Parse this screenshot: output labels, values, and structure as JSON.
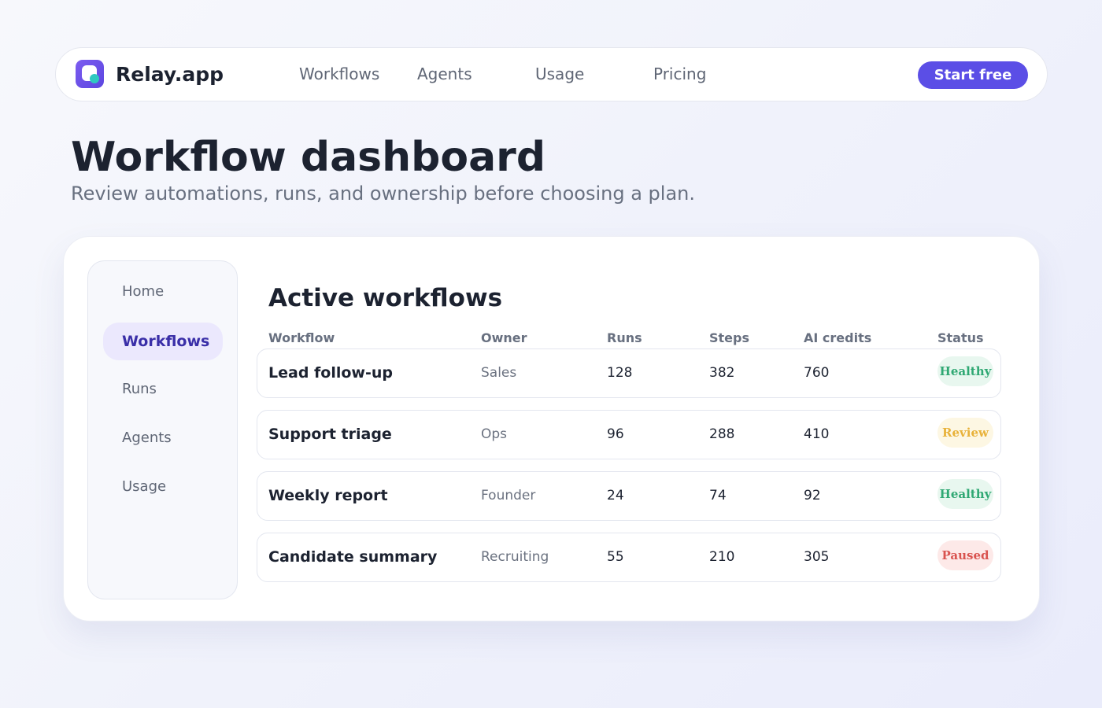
{
  "nav": {
    "brand": "Relay.app",
    "links": [
      "Workflows",
      "Agents",
      "Usage",
      "Pricing"
    ],
    "cta": "Start free"
  },
  "header": {
    "title": "Workflow dashboard",
    "subtitle": "Review automations, runs, and ownership before choosing a plan."
  },
  "sidebar": {
    "items": [
      {
        "label": "Home",
        "active": false
      },
      {
        "label": "Workflows",
        "active": true
      },
      {
        "label": "Runs",
        "active": false
      },
      {
        "label": "Agents",
        "active": false
      },
      {
        "label": "Usage",
        "active": false
      }
    ]
  },
  "main": {
    "section_title": "Active workflows",
    "columns": [
      "Workflow",
      "Owner",
      "Runs",
      "Steps",
      "AI credits",
      "Status"
    ],
    "rows": [
      {
        "workflow": "Lead follow-up",
        "owner": "Sales",
        "runs": "128",
        "steps": "382",
        "credits": "760",
        "status": "Healthy"
      },
      {
        "workflow": "Support triage",
        "owner": "Ops",
        "runs": "96",
        "steps": "288",
        "credits": "410",
        "status": "Review"
      },
      {
        "workflow": "Weekly report",
        "owner": "Founder",
        "runs": "24",
        "steps": "74",
        "credits": "92",
        "status": "Healthy"
      },
      {
        "workflow": "Candidate summary",
        "owner": "Recruiting",
        "runs": "55",
        "steps": "210",
        "credits": "305",
        "status": "Paused"
      }
    ]
  },
  "colors": {
    "accent": "#5b4ee6",
    "healthy_text": "#2fa873",
    "healthy_bg": "#e8f7ef",
    "review_text": "#e8b23a",
    "review_bg": "#fdf7e3",
    "paused_text": "#d9534f",
    "paused_bg": "#fde9e8"
  }
}
